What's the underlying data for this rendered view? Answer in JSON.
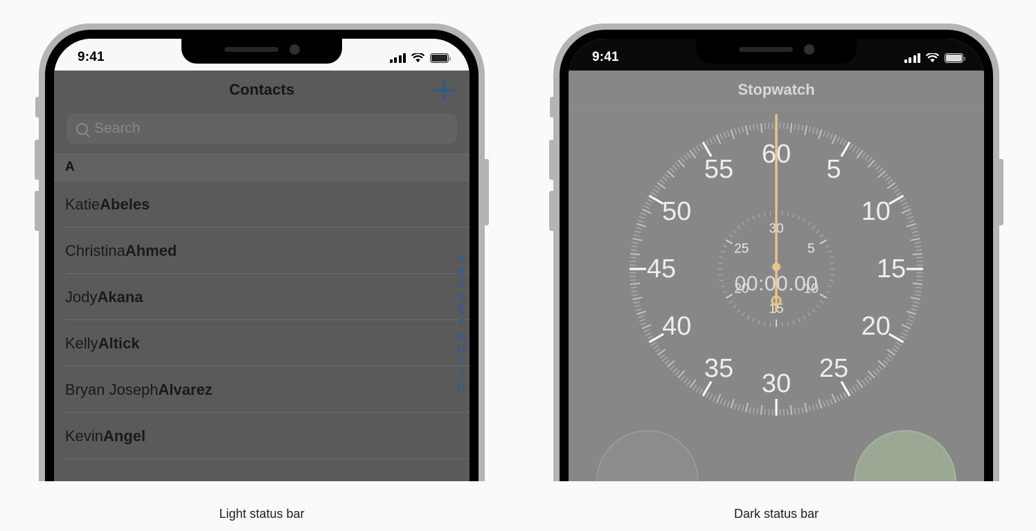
{
  "captions": {
    "left": "Light status bar",
    "right": "Dark status bar"
  },
  "colors": {
    "accent_blue": "#2f5d93",
    "stopwatch_hand": "#e8c48a",
    "start_button": "#9aa894",
    "left_screen_bg": "#5a5a5a",
    "right_screen_bg": "#878787",
    "page_bg": "#fafafa"
  },
  "left_phone": {
    "status_bar": {
      "style": "light",
      "time": "9:41",
      "cellular": "cellular-bars-icon",
      "wifi": "wifi-icon",
      "battery": "battery-full-icon"
    },
    "nav": {
      "title": "Contacts",
      "add_label": "+"
    },
    "search": {
      "placeholder": "Search",
      "value": "",
      "icon": "search-icon"
    },
    "section_header": "A",
    "contacts": [
      {
        "first": "Katie ",
        "last": "Abeles"
      },
      {
        "first": "Christina ",
        "last": "Ahmed"
      },
      {
        "first": "Jody ",
        "last": "Akana"
      },
      {
        "first": "Kelly ",
        "last": "Altick"
      },
      {
        "first": "Bryan Joseph ",
        "last": "Alvarez"
      },
      {
        "first": "Kevin ",
        "last": "Angel"
      }
    ],
    "index_letters": [
      "A",
      "B",
      "C",
      "D",
      "E",
      "F",
      "G",
      "H",
      "I",
      "J",
      "K"
    ]
  },
  "right_phone": {
    "status_bar": {
      "style": "dark",
      "time": "9:41",
      "cellular": "cellular-bars-icon",
      "wifi": "wifi-icon",
      "battery": "battery-full-icon"
    },
    "nav": {
      "title": "Stopwatch"
    },
    "stopwatch": {
      "elapsed": "00:00.00",
      "outer_dial_labels": [
        "60",
        "5",
        "10",
        "15",
        "20",
        "25",
        "30",
        "35",
        "40",
        "45",
        "50",
        "55"
      ],
      "inner_dial_labels": [
        "30",
        "5",
        "10",
        "15",
        "20",
        "25"
      ],
      "hand_position_seconds": 0,
      "buttons": {
        "lap": "",
        "start": ""
      }
    }
  }
}
